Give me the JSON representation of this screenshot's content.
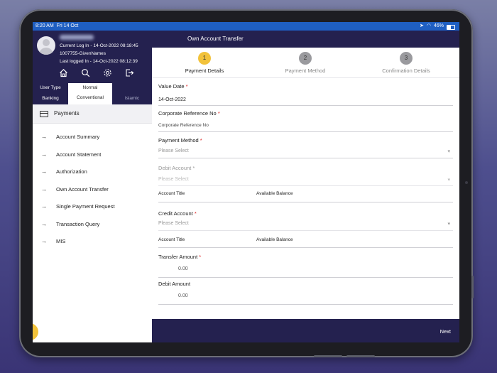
{
  "status_bar": {
    "time": "8:20 AM",
    "date": "Fri 14 Oct",
    "battery": "46%"
  },
  "profile": {
    "current_login": "Current Log In - 14-Oct-2022 08:18:45",
    "user_id": "1007755-GivenNames",
    "last_login": "Last logged In - 14-Oct-2022 08:12:39",
    "icons": [
      "home-icon",
      "search-icon",
      "gear-icon",
      "logout-icon"
    ]
  },
  "user_type": {
    "label_top": "User Type",
    "label_bottom": "Banking",
    "normal": "Normal",
    "conventional": "Conventional",
    "islamic": "Islamic"
  },
  "sidebar": {
    "section": "Payments",
    "items": [
      {
        "label": "Account Summary"
      },
      {
        "label": "Account Statement"
      },
      {
        "label": "Authorization"
      },
      {
        "label": "Own Account Transfer"
      },
      {
        "label": "Single Payment Request"
      },
      {
        "label": "Transaction Query"
      },
      {
        "label": "MIS"
      }
    ]
  },
  "header": {
    "title": "Own Account Transfer"
  },
  "steps": [
    {
      "num": "1",
      "label": "Payment Details",
      "active": true
    },
    {
      "num": "2",
      "label": "Payment Method",
      "active": false
    },
    {
      "num": "3",
      "label": "Confirmation Details",
      "active": false
    }
  ],
  "form": {
    "value_date": {
      "label": "Value Date",
      "required": "*",
      "value": "14-Oct-2022"
    },
    "corporate_ref": {
      "label": "Corporate Reference No",
      "required": "*",
      "placeholder": "Corporate Reference No"
    },
    "payment_method": {
      "label": "Payment Method",
      "required": "*",
      "placeholder": "Please Select"
    },
    "debit_account": {
      "label": "Debit Account",
      "required": "*",
      "placeholder": "Please Select",
      "account_title": "Account Title",
      "available_balance": "Available Balance"
    },
    "credit_account": {
      "label": "Credit Account",
      "required": "*",
      "placeholder": "Please Select",
      "account_title": "Account Title",
      "available_balance": "Available Balance"
    },
    "transfer_amount": {
      "label": "Transfer Amount",
      "required": "*",
      "value": "0.00"
    },
    "debit_amount": {
      "label": "Debit Amount",
      "value": "0.00"
    }
  },
  "footer": {
    "next": "Next"
  },
  "colors": {
    "navy": "#24214f",
    "accent": "#f2c23a",
    "status_bar": "#1f5fc2",
    "inactive_step": "#9a9a9e"
  }
}
